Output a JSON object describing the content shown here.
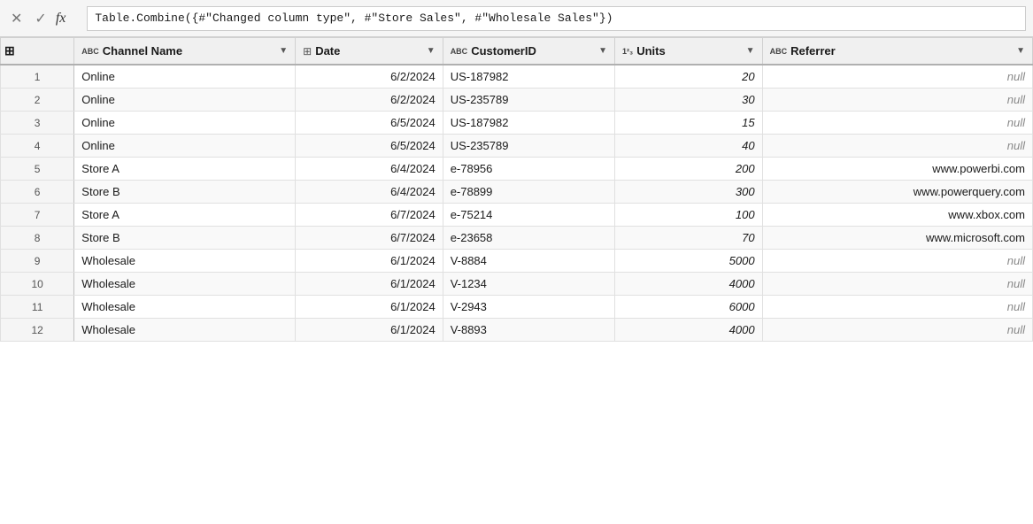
{
  "formula_bar": {
    "cross_label": "✕",
    "check_label": "✓",
    "fx_label": "fx",
    "formula_value": "Table.Combine({#\"Changed column type\", #\"Store Sales\", #\"Wholesale Sales\"})"
  },
  "table": {
    "columns": [
      {
        "id": "row_num",
        "label": "",
        "type": ""
      },
      {
        "id": "channel_name",
        "label": "Channel Name",
        "type": "ABC"
      },
      {
        "id": "date",
        "label": "Date",
        "type": "CAL"
      },
      {
        "id": "customer_id",
        "label": "CustomerID",
        "type": "ABC"
      },
      {
        "id": "units",
        "label": "Units",
        "type": "123"
      },
      {
        "id": "referrer",
        "label": "Referrer",
        "type": "ABC"
      }
    ],
    "rows": [
      {
        "row_num": "1",
        "channel_name": "Online",
        "date": "6/2/2024",
        "customer_id": "US-187982",
        "units": "20",
        "referrer": "null"
      },
      {
        "row_num": "2",
        "channel_name": "Online",
        "date": "6/2/2024",
        "customer_id": "US-235789",
        "units": "30",
        "referrer": "null"
      },
      {
        "row_num": "3",
        "channel_name": "Online",
        "date": "6/5/2024",
        "customer_id": "US-187982",
        "units": "15",
        "referrer": "null"
      },
      {
        "row_num": "4",
        "channel_name": "Online",
        "date": "6/5/2024",
        "customer_id": "US-235789",
        "units": "40",
        "referrer": "null"
      },
      {
        "row_num": "5",
        "channel_name": "Store A",
        "date": "6/4/2024",
        "customer_id": "e-78956",
        "units": "200",
        "referrer": "www.powerbi.com"
      },
      {
        "row_num": "6",
        "channel_name": "Store B",
        "date": "6/4/2024",
        "customer_id": "e-78899",
        "units": "300",
        "referrer": "www.powerquery.com"
      },
      {
        "row_num": "7",
        "channel_name": "Store A",
        "date": "6/7/2024",
        "customer_id": "e-75214",
        "units": "100",
        "referrer": "www.xbox.com"
      },
      {
        "row_num": "8",
        "channel_name": "Store B",
        "date": "6/7/2024",
        "customer_id": "e-23658",
        "units": "70",
        "referrer": "www.microsoft.com"
      },
      {
        "row_num": "9",
        "channel_name": "Wholesale",
        "date": "6/1/2024",
        "customer_id": "V-8884",
        "units": "5000",
        "referrer": "null"
      },
      {
        "row_num": "10",
        "channel_name": "Wholesale",
        "date": "6/1/2024",
        "customer_id": "V-1234",
        "units": "4000",
        "referrer": "null"
      },
      {
        "row_num": "11",
        "channel_name": "Wholesale",
        "date": "6/1/2024",
        "customer_id": "V-2943",
        "units": "6000",
        "referrer": "null"
      },
      {
        "row_num": "12",
        "channel_name": "Wholesale",
        "date": "6/1/2024",
        "customer_id": "V-8893",
        "units": "4000",
        "referrer": "null"
      }
    ]
  }
}
